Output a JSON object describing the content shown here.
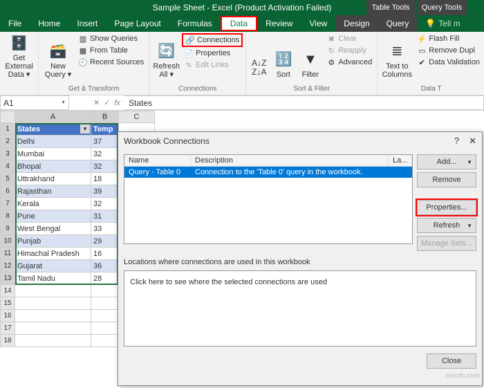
{
  "title": "Sample Sheet - Excel (Product Activation Failed)",
  "context_tabs": {
    "table": "Table Tools",
    "query": "Query Tools"
  },
  "tabs": {
    "file": "File",
    "home": "Home",
    "insert": "Insert",
    "pagelayout": "Page Layout",
    "formulas": "Formulas",
    "data": "Data",
    "review": "Review",
    "view": "View",
    "design": "Design",
    "query": "Query",
    "tell": "Tell m"
  },
  "ribbon": {
    "get_external_data": "Get External\nData ▾",
    "get_transform": {
      "label": "Get & Transform",
      "new_query": "New\nQuery ▾",
      "show_queries": "Show Queries",
      "from_table": "From Table",
      "recent_sources": "Recent Sources"
    },
    "connections": {
      "label": "Connections",
      "refresh_all": "Refresh\nAll ▾",
      "connections": "Connections",
      "properties": "Properties",
      "edit_links": "Edit Links"
    },
    "sort_filter": {
      "label": "Sort & Filter",
      "sort": "Sort",
      "filter": "Filter",
      "clear": "Clear",
      "reapply": "Reapply",
      "advanced": "Advanced"
    },
    "data_tools": {
      "label": "Data T",
      "text_to_columns": "Text to\nColumns",
      "flash_fill": "Flash Fill",
      "remove_dup": "Remove Dupl",
      "data_validation": "Data Validation"
    }
  },
  "namebox": "A1",
  "formula": "States",
  "table": {
    "headers": {
      "a": "States",
      "b": "Temp"
    },
    "rows": [
      {
        "a": "Delhi",
        "b": "37"
      },
      {
        "a": "Mumbai",
        "b": "32"
      },
      {
        "a": "Bhopal",
        "b": "32"
      },
      {
        "a": "Uttrakhand",
        "b": "18"
      },
      {
        "a": "Rajasthan",
        "b": "39"
      },
      {
        "a": "Kerala",
        "b": "32"
      },
      {
        "a": "Pune",
        "b": "31"
      },
      {
        "a": "West Bengal",
        "b": "33"
      },
      {
        "a": "Punjab",
        "b": "29"
      },
      {
        "a": "Himachal Pradesh",
        "b": "16"
      },
      {
        "a": "Gujarat",
        "b": "36"
      },
      {
        "a": "Tamil Nadu",
        "b": "28"
      }
    ]
  },
  "dialog": {
    "title": "Workbook Connections",
    "cols": {
      "name": "Name",
      "desc": "Description",
      "last": "La..."
    },
    "row": {
      "name": "Query - Table 0",
      "desc": "Connection to the 'Table 0' query in the workbook."
    },
    "btns": {
      "add": "Add...",
      "remove": "Remove",
      "properties": "Properties...",
      "refresh": "Refresh",
      "manage": "Manage Sets..."
    },
    "loc_label": "Locations where connections are used in this workbook",
    "loc_hint": "Click here to see where the selected connections are used",
    "close": "Close"
  },
  "watermark": "wsxdn.com"
}
